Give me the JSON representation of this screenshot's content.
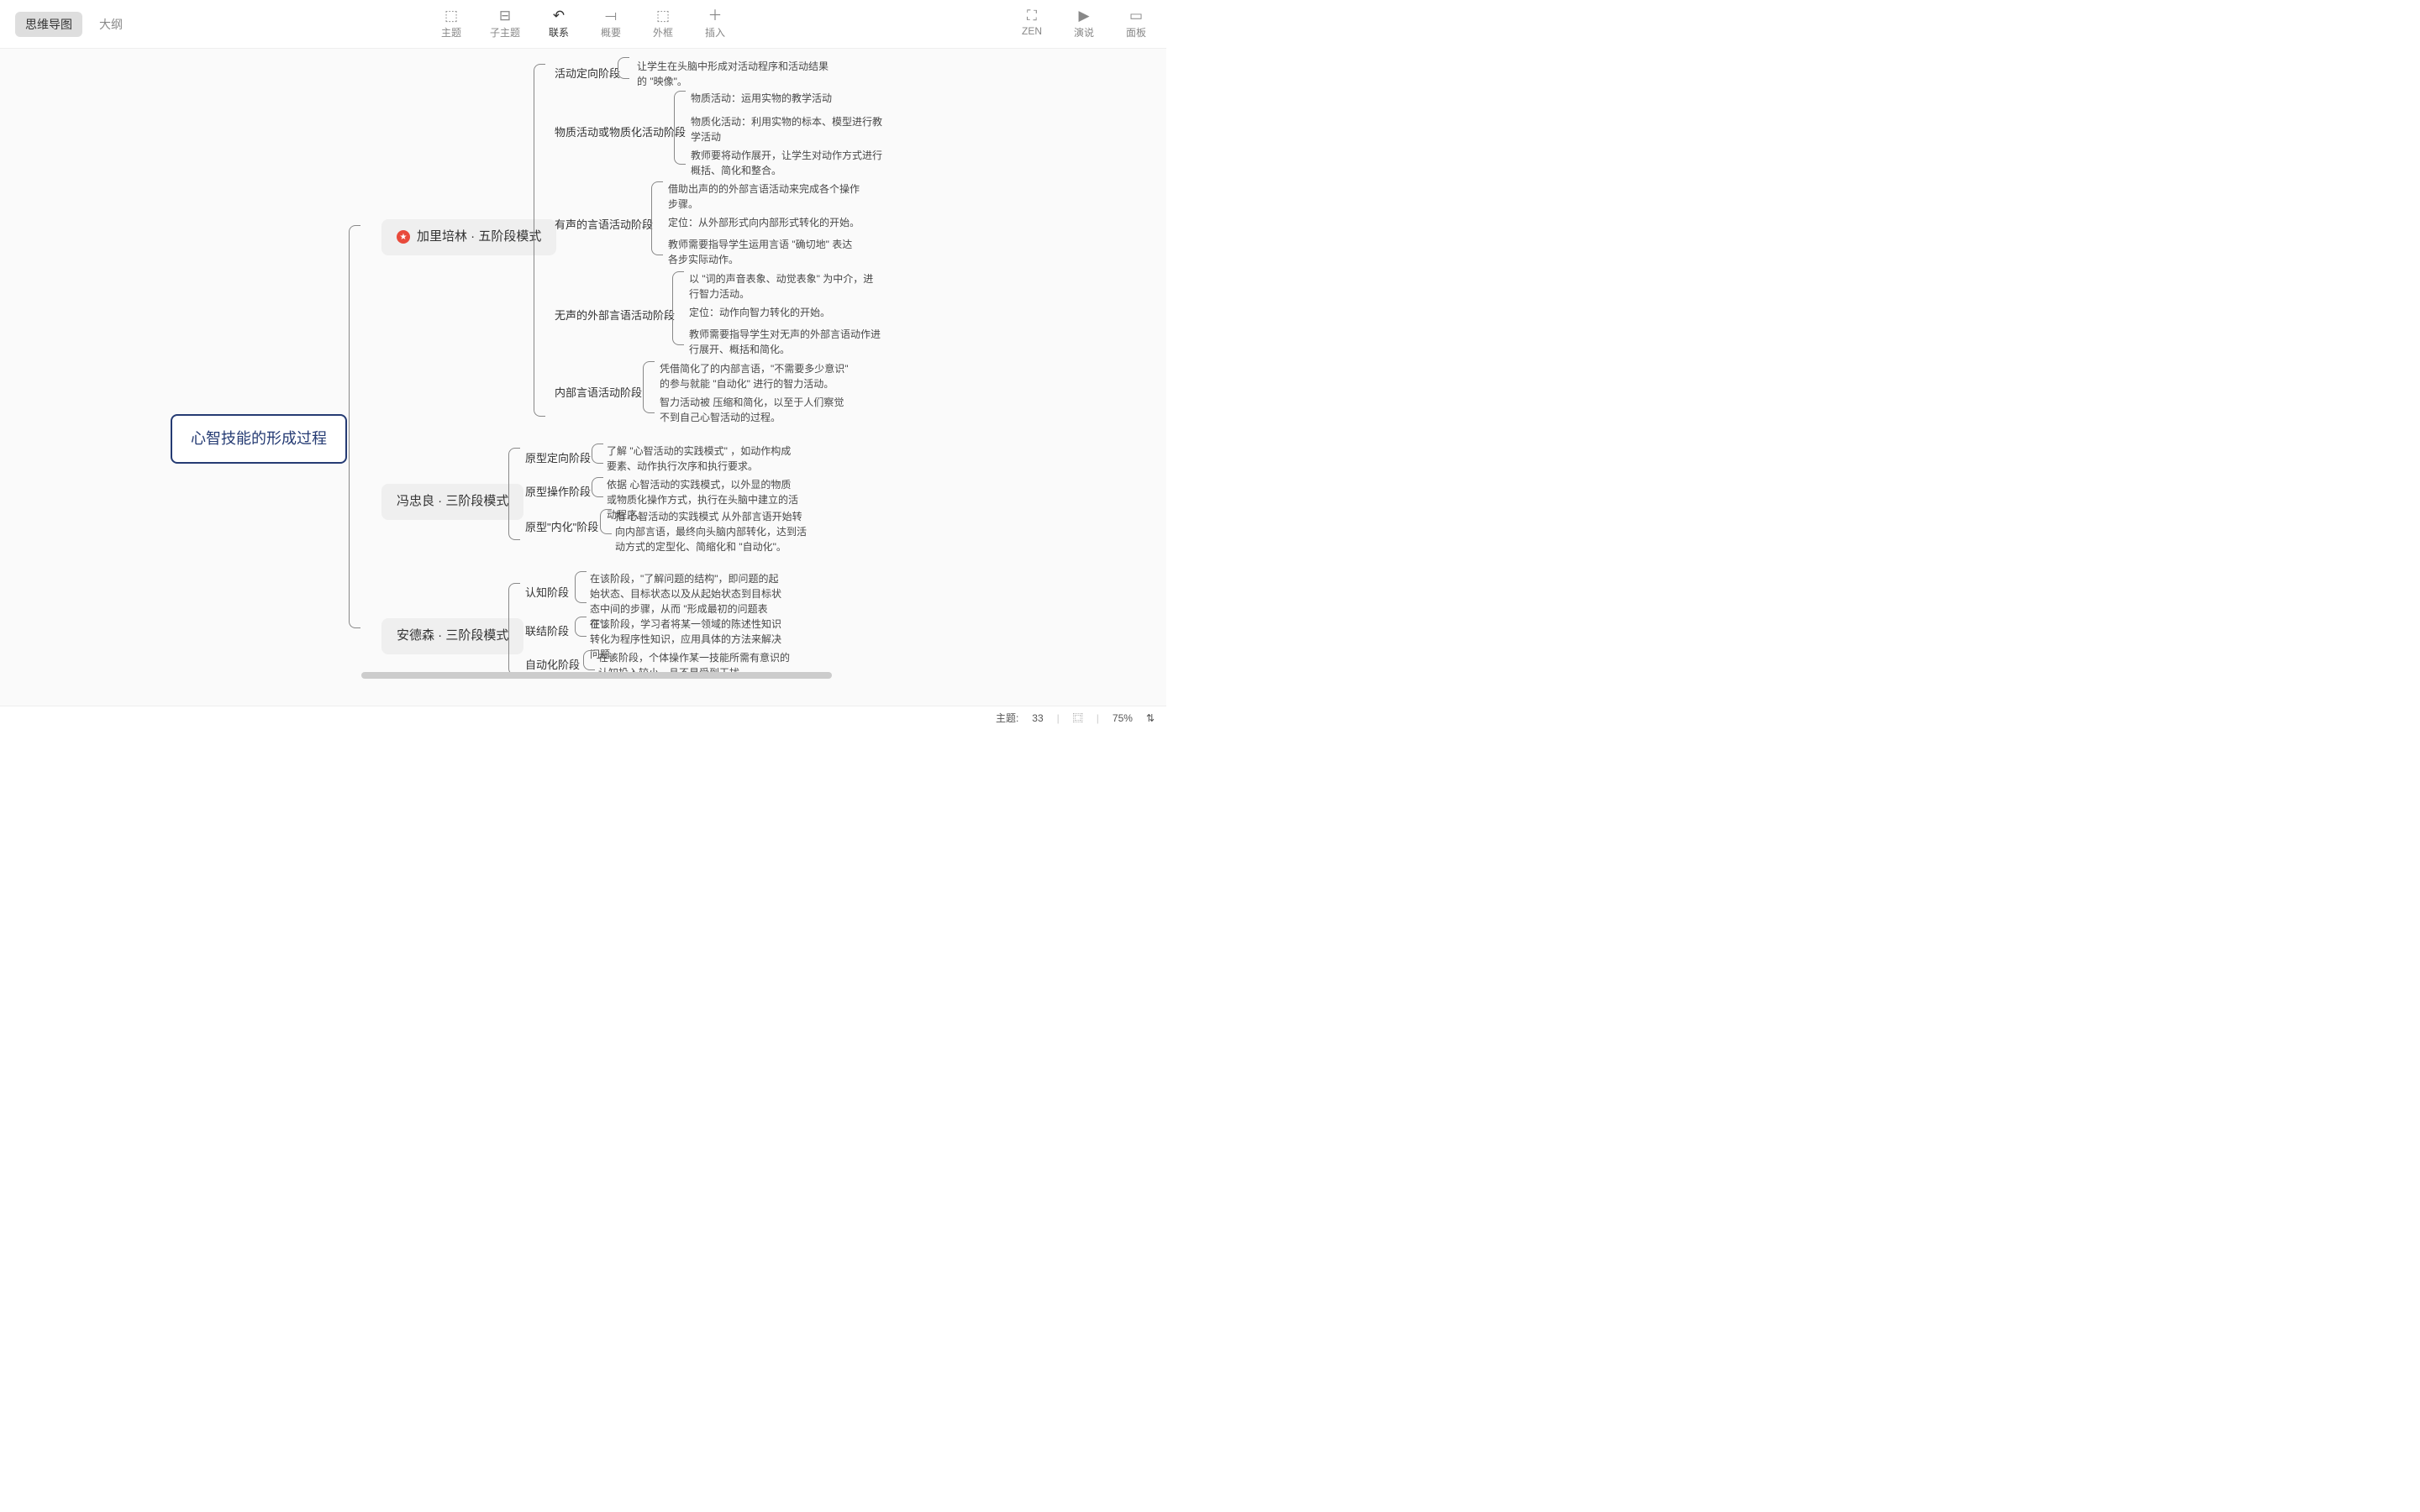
{
  "tabs": {
    "mindmap": "思维导图",
    "outline": "大纲"
  },
  "tools": {
    "topic": {
      "label": "主题",
      "icon": "⬚"
    },
    "subtopic": {
      "label": "子主题",
      "icon": "⊟"
    },
    "relation": {
      "label": "联系",
      "icon": "↶"
    },
    "summary": {
      "label": "概要",
      "icon": "⟞"
    },
    "boundary": {
      "label": "外框",
      "icon": "⬚"
    },
    "insert": {
      "label": "插入",
      "icon": "＋"
    }
  },
  "right_tools": {
    "zen": {
      "label": "ZEN",
      "icon": "⛶"
    },
    "pitch": {
      "label": "演说",
      "icon": "▶"
    },
    "panel": {
      "label": "面板",
      "icon": "▭"
    }
  },
  "root": "心智技能的形成过程",
  "b1": {
    "title": "加里培林 · 五阶段模式",
    "stages": {
      "s1": {
        "name": "活动定向阶段",
        "d1": "让学生在头脑中形成对活动程序和活动结果的 \"映像\"。"
      },
      "s2": {
        "name": "物质活动或物质化活动阶段",
        "d1": "物质活动：运用实物的教学活动",
        "d2": "物质化活动：利用实物的标本、模型进行教学活动",
        "d3": "教师要将动作展开，让学生对动作方式进行概括、简化和整合。"
      },
      "s3": {
        "name": "有声的言语活动阶段",
        "d1": "借助出声的的外部言语活动来完成各个操作步骤。",
        "d2": "定位：从外部形式向内部形式转化的开始。",
        "d3": "教师需要指导学生运用言语 \"确切地\" 表达各步实际动作。"
      },
      "s4": {
        "name": "无声的外部言语活动阶段",
        "d1": "以 \"词的声音表象、动觉表象\" 为中介，进行智力活动。",
        "d2": "定位：动作向智力转化的开始。",
        "d3": "教师需要指导学生对无声的外部言语动作进行展开、概括和简化。"
      },
      "s5": {
        "name": "内部言语活动阶段",
        "d1": "凭借简化了的内部言语，\"不需要多少意识\" 的参与就能 \"自动化\" 进行的智力活动。",
        "d2": "智力活动被 压缩和简化，以至于人们察觉不到自己心智活动的过程。"
      }
    }
  },
  "b2": {
    "title": "冯忠良 · 三阶段模式",
    "stages": {
      "s1": {
        "name": "原型定向阶段",
        "d1": "了解 \"心智活动的实践模式\" ，如动作构成要素、动作执行次序和执行要求。"
      },
      "s2": {
        "name": "原型操作阶段",
        "d1": "依据 心智活动的实践模式，以外显的物质或物质化操作方式，执行在头脑中建立的活动程序。"
      },
      "s3": {
        "name": "原型\"内化\"阶段",
        "d1": "指 心智活动的实践模式 从外部言语开始转向内部言语，最终向头脑内部转化，达到活动方式的定型化、简缩化和 \"自动化\"。"
      }
    }
  },
  "b3": {
    "title": "安德森 · 三阶段模式",
    "stages": {
      "s1": {
        "name": "认知阶段",
        "d1": "在该阶段，\"了解问题的结构\"，即问题的起始状态、目标状态以及从起始状态到目标状态中间的步骤，从而 \"形成最初的问题表征\"。"
      },
      "s2": {
        "name": "联结阶段",
        "d1": "在该阶段，学习者将某一领域的陈述性知识转化为程序性知识，应用具体的方法来解决问题。"
      },
      "s3": {
        "name": "自动化阶段",
        "d1": "在该阶段，个体操作某一技能所需有意识的认知投入较小，且不易受到干扰。"
      }
    }
  },
  "status": {
    "topics_label": "主题:",
    "topics_count": "33",
    "zoom": "75%",
    "map_icon": "⿴",
    "stepper": "⇅"
  }
}
